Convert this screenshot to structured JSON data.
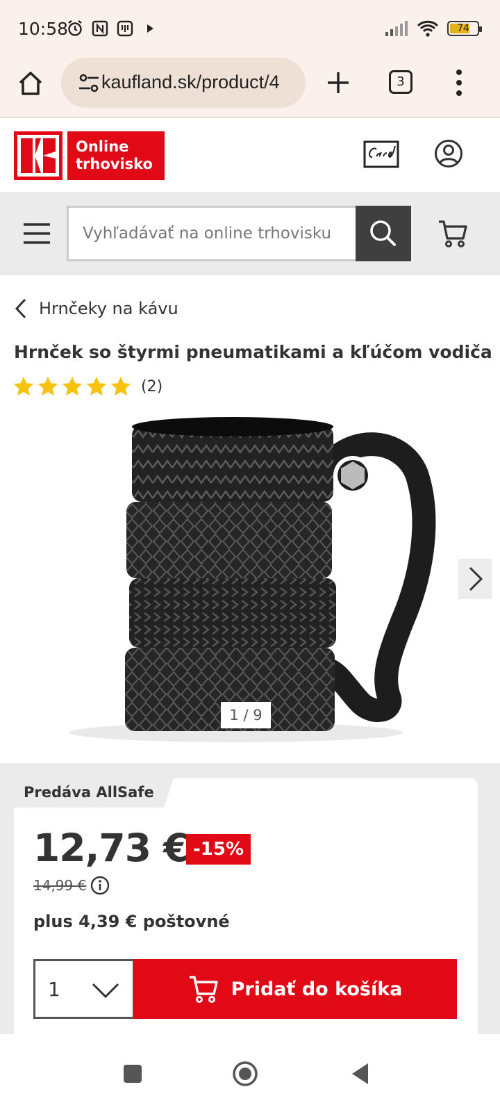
{
  "status_bar": {
    "time": "10:58",
    "battery_level": "74",
    "battery_fraction": 0.74
  },
  "browser": {
    "url": "kaufland.sk/product/4",
    "tab_count": "3"
  },
  "site": {
    "logo_text": "Online trhovisko",
    "brand_color": "#e10915"
  },
  "search": {
    "placeholder": "Vyhľadávať na online trhovisku"
  },
  "breadcrumb": {
    "label": "Hrnčeky na kávu"
  },
  "product": {
    "title": "Hrnček so štyrmi pneumatikami a kľúčom vodiča",
    "rating_stars": 5,
    "rating_count": "(2)",
    "image_pager": "1 / 9"
  },
  "buy_box": {
    "seller": "Predáva AllSafe",
    "price": "12,73 €",
    "discount": "-15%",
    "old_price": "14,99 €",
    "shipping": "plus 4,39 € poštovné",
    "quantity": "1",
    "add_to_cart_label": "Pridať do košíka"
  },
  "icons": {
    "status_left": [
      "alarm-icon",
      "nfc-icon",
      "notification-icon",
      "play-icon"
    ],
    "status_right": [
      "signal-icon",
      "wifi-icon",
      "battery-icon"
    ]
  }
}
